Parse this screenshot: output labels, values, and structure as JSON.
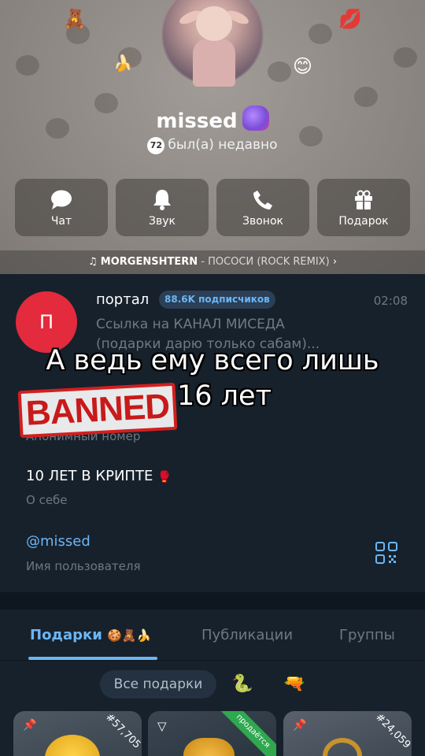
{
  "profile": {
    "name": "missed",
    "level": "72",
    "status": "был(а) недавно"
  },
  "actions": [
    {
      "label": "Чат",
      "icon": "chat-bubble-icon"
    },
    {
      "label": "Звук",
      "icon": "bell-icon"
    },
    {
      "label": "Звонок",
      "icon": "phone-icon"
    },
    {
      "label": "Подарок",
      "icon": "gift-icon"
    }
  ],
  "music": {
    "artist": "MORGENSHTERN",
    "sep": " - ",
    "track": "ПОСОСИ (ROCK REMIX)",
    "chevron": "›"
  },
  "channel": {
    "avatar_letter": "П",
    "name": "портал",
    "subscribers": "88.6K подписчиков",
    "time": "02:08",
    "desc_line1": "Ссылка на КАНАЛ МИСЕДА",
    "desc_line2": "(подарки дарю только сабам)..."
  },
  "overlay": {
    "line1": "А ведь ему всего лишь",
    "line2": "16 лет",
    "stamp": "BANNED"
  },
  "fields": {
    "phone_label": "Анонимный номер",
    "bio_value": "10 ЛЕТ В КРИПТЕ",
    "bio_label": "О себе",
    "username_value": "@missed",
    "username_label": "Имя пользователя"
  },
  "tabs": [
    {
      "label": "Подарки",
      "active": true
    },
    {
      "label": "Публикации",
      "active": false
    },
    {
      "label": "Группы",
      "active": false
    }
  ],
  "filter": {
    "all_gifts": "Все подарки"
  },
  "gifts": [
    {
      "number": "#57,705",
      "pinned": true
    },
    {
      "badge": "продаётся",
      "pinned": false
    },
    {
      "number": "#24,059",
      "pinned": true
    }
  ],
  "colors": {
    "accent": "#6bb6f5",
    "channel_avatar": "#e42a3d",
    "stamp_red": "#d21f1f",
    "background": "#17212b"
  }
}
